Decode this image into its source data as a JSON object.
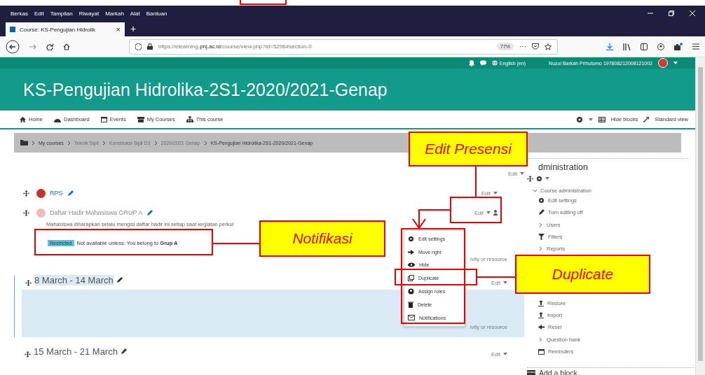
{
  "browser": {
    "menu_bar": [
      "Berkas",
      "Edit",
      "Tampilan",
      "Riwayat",
      "Markah",
      "Alat",
      "Bantuan"
    ],
    "tab": {
      "title": "Course: KS-Pengujian Hidrolik",
      "close": "×"
    },
    "new_tab": "+",
    "url": "https://elearning.**pnj.ac.id**/course/view.php?id=5296#section-0",
    "zoom": "77%",
    "more": "···"
  },
  "moodle_navbar": {
    "language": "English (en)",
    "user": "Nuzul Barkah Prihutomo 197808212008121002"
  },
  "course_title": "KS-Pengujian Hidrolika-2S1-2020/2021-Genap",
  "nav": {
    "items": [
      "Home",
      "Dashboard",
      "Events",
      "My Courses",
      "This course"
    ],
    "right": [
      "Hide blocks",
      "Standard view"
    ]
  },
  "breadcrumb": [
    "My courses",
    "Teknik Sipil",
    "Konstruksi Sipil D3",
    "2020/2021 Genap",
    "KS-Pengujian Hidrolika-2S1-2020/2021-Genap"
  ],
  "section0": {
    "edit": "Edit",
    "activities": [
      {
        "name": "RPS",
        "edit": "Edit",
        "hidden": false
      },
      {
        "name": "Daftar Hadir Mahasiswa GRUP A",
        "edit": "Edit",
        "hidden": true,
        "description": "Mahasiswa diharapkan selalu mengisi daftar hadir ini setiap saat kegiatan perkul",
        "restriction": {
          "badge": "Restricted",
          "text": "Not available unless: You belong to **Grup A**"
        }
      }
    ],
    "add_activity": "ivity or resource"
  },
  "action_menu": [
    "Edit settings",
    "Move right",
    "Hide",
    "Duplicate",
    "Assign roles",
    "Delete",
    "Notifications"
  ],
  "sections": [
    {
      "title": "8 March - 14 March",
      "edit": "Edit",
      "highlighted": true,
      "add_activity": "ivity or resource"
    },
    {
      "title": "15 March - 21 March",
      "edit": "Edit",
      "highlighted": false
    }
  ],
  "admin_block": {
    "title": "dministration",
    "category": {
      "label": "Course administration",
      "expanded": true
    },
    "items": [
      {
        "label": "Edit settings",
        "kind": "link"
      },
      {
        "label": "Turn editing off",
        "kind": "link"
      },
      {
        "label": "Users",
        "kind": "category"
      },
      {
        "label": "Filters",
        "kind": "link"
      },
      {
        "label": "Reports",
        "kind": "category"
      },
      {
        "label": "Restore",
        "kind": "link"
      },
      {
        "label": "Import",
        "kind": "link"
      },
      {
        "label": "Reset",
        "kind": "link"
      },
      {
        "label": "Question bank",
        "kind": "category"
      },
      {
        "label": "Reminders",
        "kind": "link"
      }
    ]
  },
  "add_block": "Add a block",
  "annotations": [
    "Edit Presensi",
    "Notifikasi",
    "Duplicate"
  ]
}
